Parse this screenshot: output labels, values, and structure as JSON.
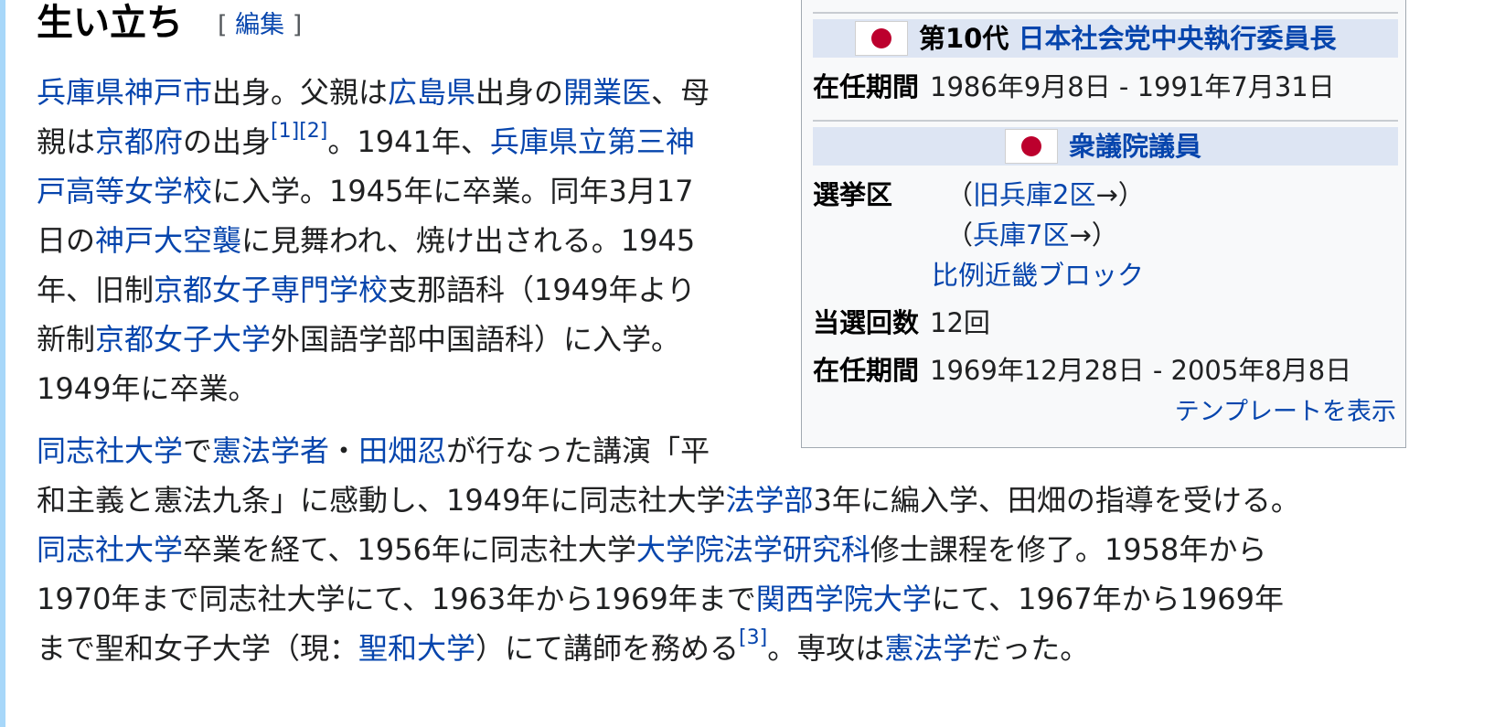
{
  "section": {
    "title": "生い立ち",
    "edit_open": "[",
    "edit_label": "編集",
    "edit_close": "]"
  },
  "infobox": {
    "role1": {
      "prefix": "第10代",
      "title": "日本社会党中央執行委員長"
    },
    "term1_label": "在任期間",
    "term1_value": "1986年9月8日 - 1991年7月31日",
    "role2": {
      "title": "衆議院議員"
    },
    "district_label": "選挙区",
    "districts": [
      {
        "open": "（",
        "name": "旧兵庫2区",
        "arrow": "→",
        "close": "）"
      },
      {
        "open": "（",
        "name": "兵庫7区",
        "arrow": "→",
        "close": "）"
      },
      {
        "open": "",
        "name": "比例近畿ブロック",
        "arrow": "",
        "close": ""
      }
    ],
    "elections_label": "当選回数",
    "elections_value": "12回",
    "term2_label": "在任期間",
    "term2_value": "1969年12月28日 - 2005年8月8日",
    "footer_link": "テンプレートを表示"
  },
  "paragraph1": [
    [
      {
        "t": "兵庫県神戸市",
        "link": true
      },
      {
        "t": "出身。父親は"
      },
      {
        "t": "広島県",
        "link": true
      },
      {
        "t": "出身の"
      },
      {
        "t": "開業医",
        "link": true
      },
      {
        "t": "、母"
      }
    ],
    [
      {
        "t": "親は"
      },
      {
        "t": "京都府",
        "link": true
      },
      {
        "t": "の出身"
      },
      {
        "t": "[1]",
        "link": true,
        "sup": true
      },
      {
        "t": "[2]",
        "link": true,
        "sup": true
      },
      {
        "t": "。1941年、"
      },
      {
        "t": "兵庫県立第三神",
        "link": true
      }
    ],
    [
      {
        "t": "戸高等女学校",
        "link": true
      },
      {
        "t": "に入学。1945年に卒業。同年3月17"
      }
    ],
    [
      {
        "t": "日の"
      },
      {
        "t": "神戸大空襲",
        "link": true
      },
      {
        "t": "に見舞われ、焼け出される。1945"
      }
    ],
    [
      {
        "t": "年、旧制"
      },
      {
        "t": "京都女子専門学校",
        "link": true
      },
      {
        "t": "支那語科（1949年より"
      }
    ],
    [
      {
        "t": "新制"
      },
      {
        "t": "京都女子大学",
        "link": true
      },
      {
        "t": "外国語学部中国語科）に入学。"
      }
    ],
    [
      {
        "t": "1949年に卒業。"
      }
    ]
  ],
  "paragraph2": [
    [
      {
        "t": "同志社大学",
        "link": true
      },
      {
        "t": "で"
      },
      {
        "t": "憲法学者",
        "link": true
      },
      {
        "t": "・"
      },
      {
        "t": "田畑忍",
        "link": true
      },
      {
        "t": "が行なった講演「平"
      }
    ],
    [
      {
        "t": "和主義と憲法九条」に感動し、1949年に同志社大学"
      },
      {
        "t": "法学部",
        "link": true
      },
      {
        "t": "3年に編入学、田畑の指導を受ける。"
      }
    ],
    [
      {
        "t": "同志社大学",
        "link": true
      },
      {
        "t": "卒業を経て、1956年に同志社大学"
      },
      {
        "t": "大学院法学研究科",
        "link": true
      },
      {
        "t": "修士課程を修了。1958年から"
      }
    ],
    [
      {
        "t": "1970年まで同志社大学にて、1963年から1969年まで"
      },
      {
        "t": "関西学院大学",
        "link": true
      },
      {
        "t": "にて、1967年から1969年"
      }
    ],
    [
      {
        "t": "まで聖和女子大学（現："
      },
      {
        "t": "聖和大学",
        "link": true
      },
      {
        "t": "）にて講師を務める"
      },
      {
        "t": "[3]",
        "link": true,
        "sup": true
      },
      {
        "t": "。専攻は"
      },
      {
        "t": "憲法学",
        "link": true
      },
      {
        "t": "だった。"
      }
    ]
  ],
  "colors": {
    "link": "#0645ad",
    "infobox_band": "#dde5f3",
    "flag_red": "#bc002d"
  }
}
